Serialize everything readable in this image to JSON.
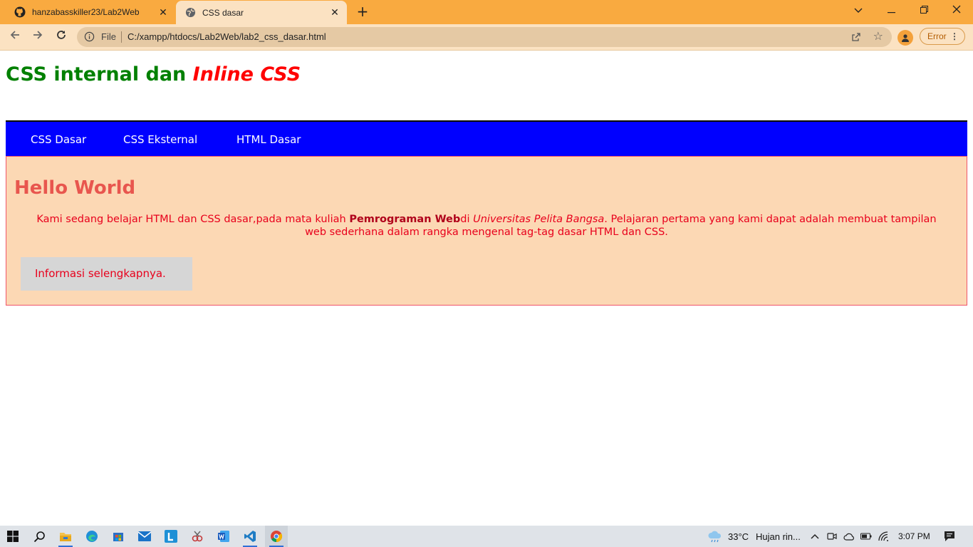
{
  "browser": {
    "tabs": [
      {
        "title": "hanzabasskiller23/Lab2Web",
        "icon": "github-icon"
      },
      {
        "title": "CSS dasar",
        "icon": "globe-icon",
        "active": true
      }
    ],
    "new_tab": "+",
    "address": {
      "scheme_label": "File",
      "url": "C:/xampp/htdocs/Lab2Web/lab2_css_dasar.html"
    },
    "profile_error_label": "Error"
  },
  "page": {
    "heading_plain": "CSS internal dan ",
    "heading_italic": "Inline CSS",
    "nav": [
      "CSS Dasar",
      "CSS Eksternal",
      "HTML Dasar"
    ],
    "hello_title": "Hello World",
    "paragraph": {
      "part1": "Kami sedang belajar HTML dan CSS dasar,pada mata kuliah ",
      "bold": "Pemrograman Web",
      "part2": "di ",
      "italic": "Universitas Pelita Bangsa",
      "part3": ". Pelajaran pertama yang kami dapat adalah membuat tampilan web sederhana dalam rangka mengenal tag-tag dasar HTML dan CSS."
    },
    "more_button": "Informasi selengkapnya."
  },
  "taskbar": {
    "weather_temp": "33°C",
    "weather_desc": "Hujan rin...",
    "clock": "3:07 PM"
  },
  "colors": {
    "chrome_tabbar": "#f9aa40",
    "chrome_toolbar": "#fbe2c2",
    "heading_green": "#008000",
    "heading_red": "#ff0000",
    "nav_blue": "#0000ff",
    "content_bg": "#fcd8b4",
    "hello_color": "#e8564e"
  }
}
